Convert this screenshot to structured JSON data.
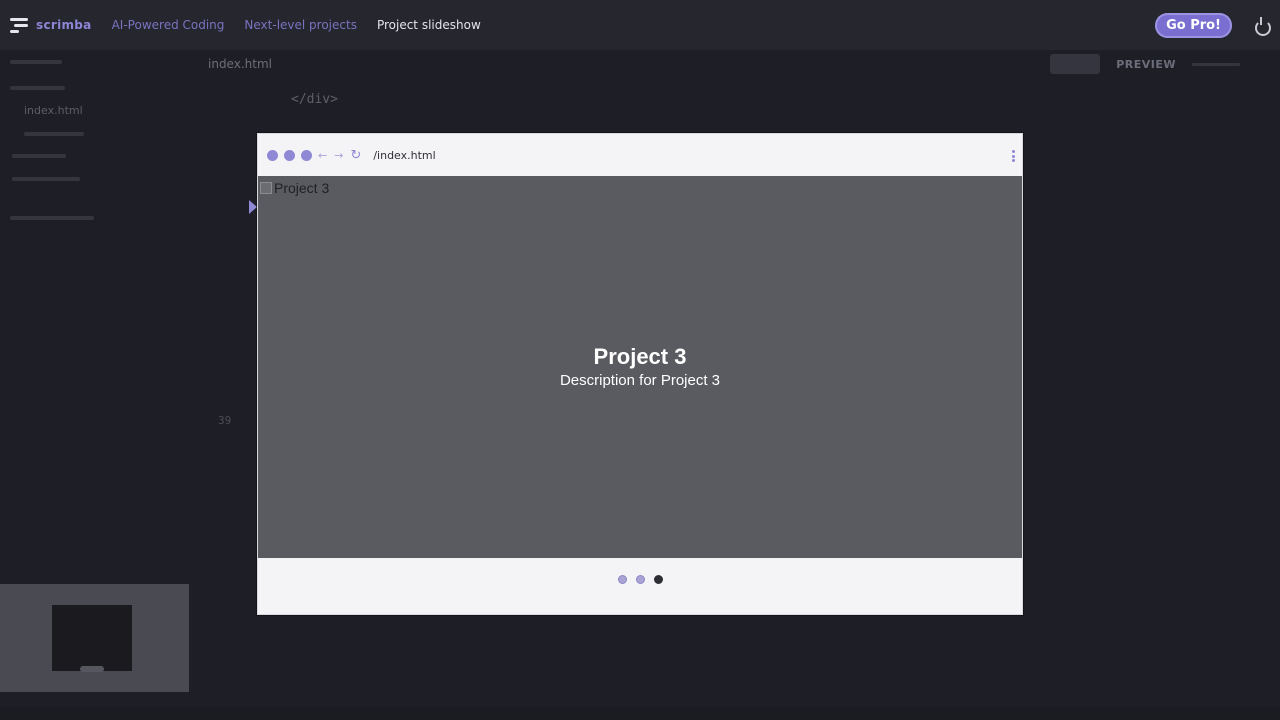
{
  "topbar": {
    "brand": "scrimba",
    "breadcrumbs": [
      "AI-Powered Coding",
      "Next-level projects",
      "Project slideshow"
    ],
    "go_pro": "Go Pro!"
  },
  "sidebar": {
    "items": [
      "index.html"
    ]
  },
  "editor": {
    "tab": "index.html",
    "code_line": "</div>",
    "line_number": "39",
    "preview_tab": "PREVIEW"
  },
  "preview": {
    "url": "/index.html",
    "image_alt": "Project 3",
    "title": "Project 3",
    "description": "Description for Project 3",
    "slides_total": 3,
    "active_slide": 3
  },
  "colors": {
    "accent": "#8f88d4",
    "slide_bg": "#5a5b61",
    "app_bg": "#1e1f26"
  }
}
